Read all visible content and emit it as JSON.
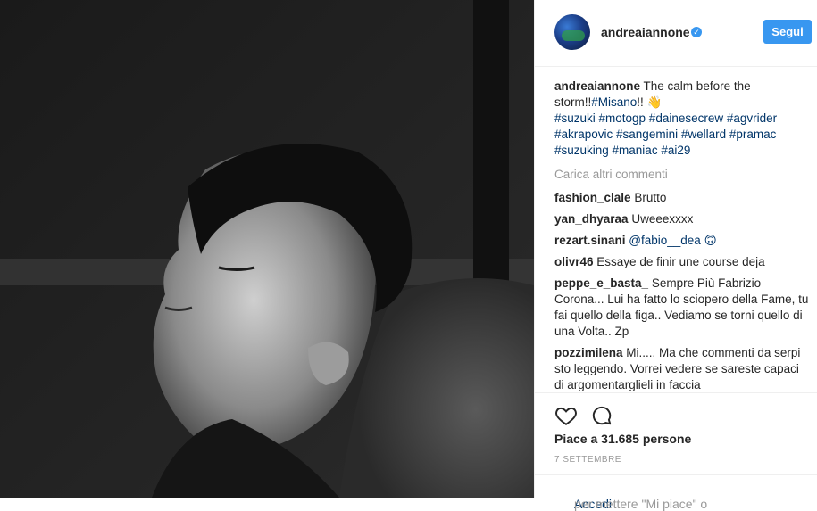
{
  "post": {
    "username": "andreaiannone",
    "follow_label": "Segui",
    "caption_text": " The calm before the storm!!",
    "caption_mention": "#Misano",
    "caption_tail": "!! 👋",
    "hashtags_line1": "#suzuki #motogp #dainesecrew #agvrider",
    "hashtags_line2": "#akrapovic #sangemini #wellard #pramac",
    "hashtags_line3": "#suzuking #maniac #ai29",
    "load_more": "Carica altri commenti",
    "comments": [
      {
        "user": "fashion_clale",
        "text": "Brutto"
      },
      {
        "user": "yan_dhyaraa",
        "text": "Uweeexxxx"
      },
      {
        "user": "rezart.sinani",
        "text": "@fabio__dea 🙃"
      },
      {
        "user": "olivr46",
        "text": "Essaye de finir une course deja"
      },
      {
        "user": "peppe_e_basta_",
        "text": "Sempre Più Fabrizio Corona... Lui ha fatto lo sciopero della Fame, tu fai quello della figa.. Vediamo se torni quello di una Volta.. Zp"
      },
      {
        "user": "pozzimilena",
        "text": "Mi..... Ma che commenti da serpi sto leggendo. Vorrei vedere se sareste capaci di argomentarglieli in faccia"
      }
    ],
    "likes_text": "Piace a 31.685 persone",
    "date_text": "7 SETTEMBRE",
    "footer_link": "Accedi",
    "footer_text": " per mettere \"Mi piace\" o"
  },
  "icons": {
    "like": "heart-icon",
    "comment": "comment-icon",
    "verified": "verified-badge-icon"
  }
}
